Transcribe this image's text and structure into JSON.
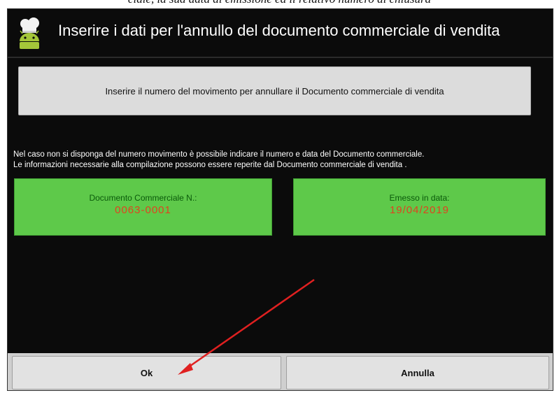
{
  "document": {
    "header_fragment": "ciale, la sua data di emissione ed il relativo numero di chiusura"
  },
  "dialog": {
    "title": "Inserire i dati per l'annullo del documento commerciale di vendita",
    "movement_button_label": "Inserire il numero del movimento per annullare il Documento commerciale di vendita",
    "info_line1": "Nel caso non si disponga del numero movimento è possibile indicare il numero e data del Documento commerciale.",
    "info_line2": "Le informazioni necessarie alla compilazione possono essere reperite dal Documento commerciale di vendita .",
    "document_number": {
      "label": "Documento Commerciale N.:",
      "value": "0063-0001"
    },
    "issue_date": {
      "label": "Emesso in data:",
      "value": "19/04/2019"
    },
    "buttons": {
      "ok": "Ok",
      "cancel": "Annulla"
    }
  },
  "icons": {
    "app_icon": "android-chef-icon",
    "annotation": "red-arrow-icon"
  },
  "colors": {
    "dialog_background": "#0b0b0b",
    "field_green": "#5ec94a",
    "field_label": "#0a5a0a",
    "field_value": "#e0431f",
    "annotation_red": "#e02020"
  }
}
